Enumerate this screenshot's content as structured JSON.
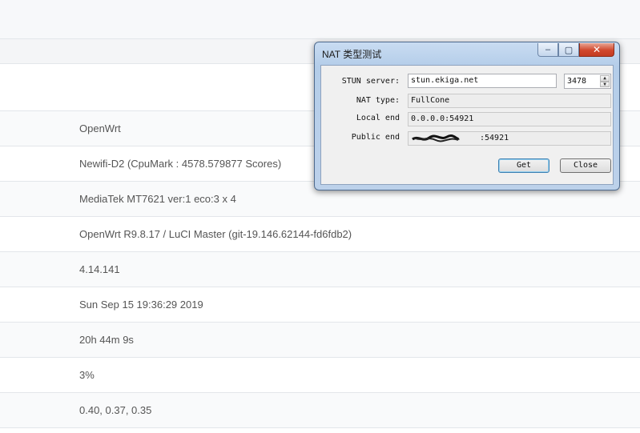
{
  "background": {
    "values": [
      "OpenWrt",
      "Newifi-D2 (CpuMark : 4578.579877 Scores)",
      "MediaTek MT7621 ver:1 eco:3 x 4",
      "OpenWrt R9.8.17 / LuCI Master (git-19.146.62144-fd6fdb2)",
      "4.14.141",
      "Sun Sep 15 19:36:29 2019",
      "20h 44m 9s",
      "3%",
      "0.40, 0.37, 0.35"
    ]
  },
  "dialog": {
    "title": "NAT 类型测试",
    "window_buttons": {
      "minimize": "–",
      "maximize": "▢",
      "close": "✕"
    },
    "stun_server_label": "STUN server:",
    "stun_server_value": "stun.ekiga.net",
    "stun_port": "3478",
    "nat_type_label": "NAT type:",
    "nat_type_value": "FullCone",
    "local_end_label": "Local end",
    "local_end_value": "0.0.0.0:54921",
    "public_end_label": "Public end",
    "public_end_visible_suffix": ":54921",
    "get_button": "Get",
    "close_button": "Close"
  },
  "icons": {
    "spin_up": "spin-up-icon",
    "spin_down": "spin-down-icon"
  },
  "colors": {
    "dialog_frame": "#b4cde9",
    "close_button": "#d1472c",
    "default_button_border": "#3c7fb1"
  }
}
